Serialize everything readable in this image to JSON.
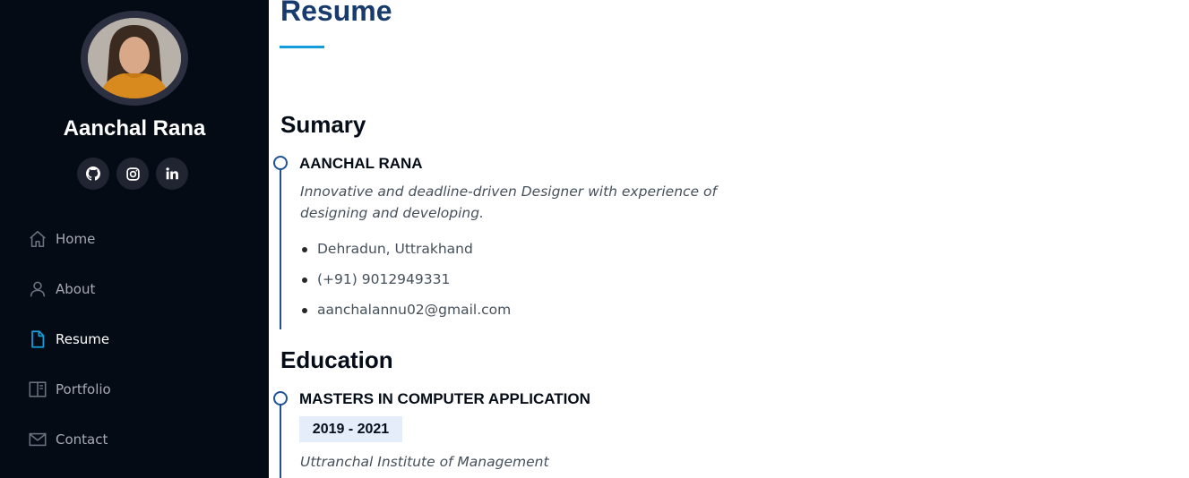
{
  "sidebar": {
    "profile": {
      "name": "Aanchal Rana"
    },
    "socials": [
      {
        "icon": "github-icon"
      },
      {
        "icon": "instagram-icon"
      },
      {
        "icon": "linkedin-icon"
      }
    ],
    "nav": [
      {
        "label": "Home",
        "icon": "home-icon",
        "active": false
      },
      {
        "label": "About",
        "icon": "user-icon",
        "active": false
      },
      {
        "label": "Resume",
        "icon": "file-icon",
        "active": true
      },
      {
        "label": "Portfolio",
        "icon": "portfolio-icon",
        "active": false
      },
      {
        "label": "Contact",
        "icon": "envelope-icon",
        "active": false
      }
    ]
  },
  "main": {
    "title": "Resume",
    "summary": {
      "heading": "Sumary",
      "name": "AANCHAL RANA",
      "description": "Innovative and deadline-driven Designer with experience of designing and developing.",
      "details": [
        "Dehradun, Uttrakhand",
        "(+91) 9012949331",
        "aanchalannu02@gmail.com"
      ]
    },
    "education": {
      "heading": "Education",
      "items": [
        {
          "degree": "MASTERS IN COMPUTER APPLICATION",
          "years": "2019 - 2021",
          "institution": "Uttranchal Institute of Management"
        }
      ]
    }
  },
  "colors": {
    "sidebar_bg": "#040b14",
    "accent": "#149ddd",
    "title": "#173b6c",
    "timeline": "#1f5297",
    "badge_bg": "#e4edf9"
  }
}
